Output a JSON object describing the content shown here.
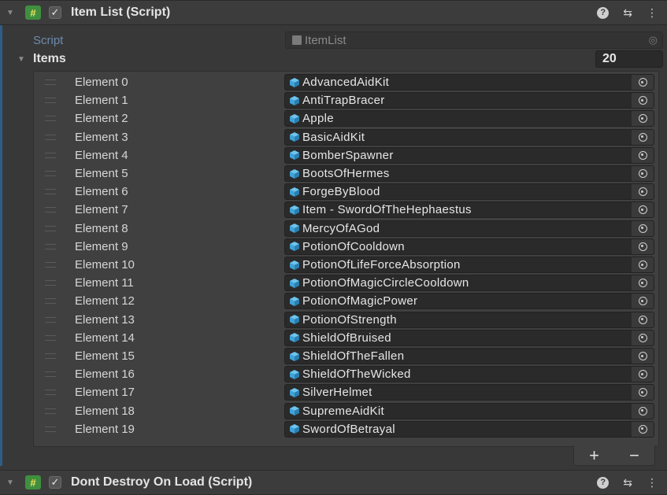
{
  "component1": {
    "title": "Item List (Script)",
    "icon": "hash-icon",
    "enabled": true
  },
  "script_field": {
    "label": "Script",
    "value": "ItemList"
  },
  "items": {
    "label": "Items",
    "count": "20",
    "elements": [
      {
        "label": "Element 0",
        "value": "AdvancedAidKit"
      },
      {
        "label": "Element 1",
        "value": "AntiTrapBracer"
      },
      {
        "label": "Element 2",
        "value": "Apple"
      },
      {
        "label": "Element 3",
        "value": "BasicAidKit"
      },
      {
        "label": "Element 4",
        "value": "BomberSpawner"
      },
      {
        "label": "Element 5",
        "value": "BootsOfHermes"
      },
      {
        "label": "Element 6",
        "value": "ForgeByBlood"
      },
      {
        "label": "Element 7",
        "value": "Item - SwordOfTheHephaestus"
      },
      {
        "label": "Element 8",
        "value": "MercyOfAGod"
      },
      {
        "label": "Element 9",
        "value": "PotionOfCooldown"
      },
      {
        "label": "Element 10",
        "value": "PotionOfLifeForceAbsorption"
      },
      {
        "label": "Element 11",
        "value": "PotionOfMagicCircleCooldown"
      },
      {
        "label": "Element 12",
        "value": "PotionOfMagicPower"
      },
      {
        "label": "Element 13",
        "value": "PotionOfStrength"
      },
      {
        "label": "Element 14",
        "value": "ShieldOfBruised"
      },
      {
        "label": "Element 15",
        "value": "ShieldOfTheFallen"
      },
      {
        "label": "Element 16",
        "value": "ShieldOfTheWicked"
      },
      {
        "label": "Element 17",
        "value": "SilverHelmet"
      },
      {
        "label": "Element 18",
        "value": "SupremeAidKit"
      },
      {
        "label": "Element 19",
        "value": "SwordOfBetrayal"
      }
    ],
    "add_label": "+",
    "remove_label": "−"
  },
  "component2": {
    "title": "Dont Destroy On Load (Script)",
    "icon": "script-hash-icon",
    "enabled": true
  },
  "colors": {
    "hash_icon_bg": "#3f8f3f",
    "hash_icon_fg": "#f0e05a",
    "asset_cube": "#3fa3d8",
    "script_label": "#6e8bb0",
    "accent": "#2c5d87"
  }
}
